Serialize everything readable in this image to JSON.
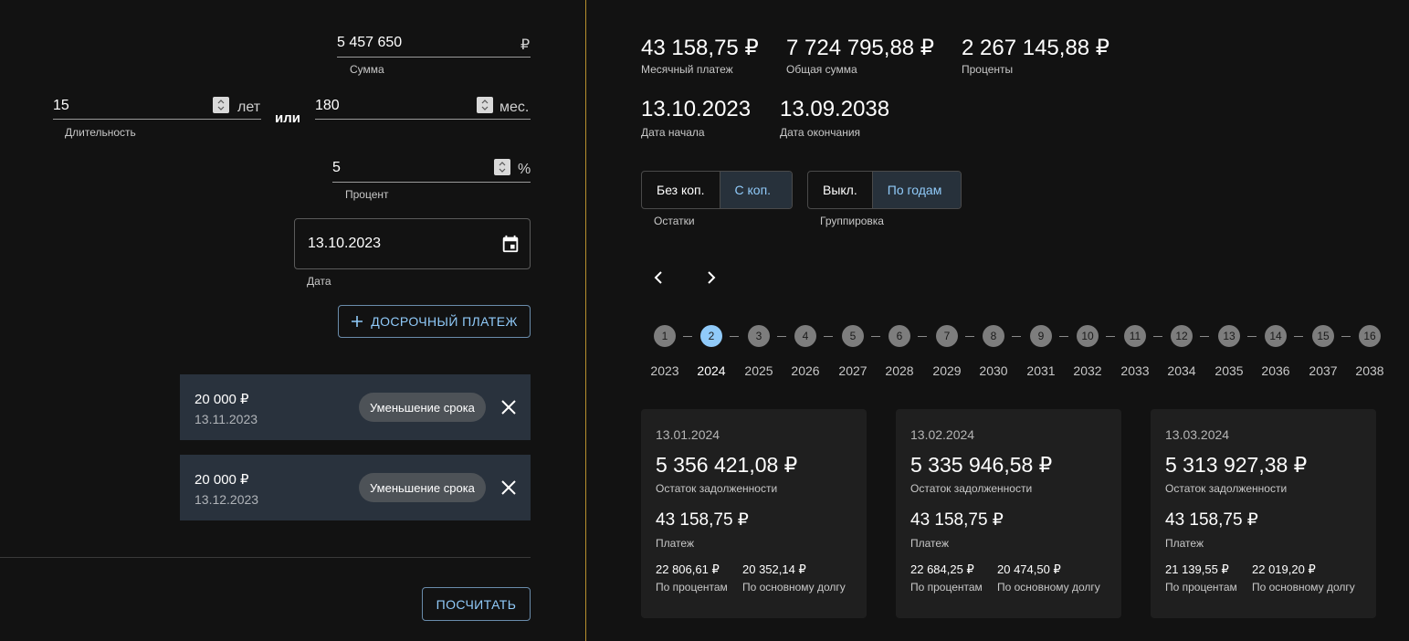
{
  "form": {
    "sum": {
      "value": "5 457 650",
      "suffix": "₽",
      "label": "Сумма"
    },
    "duration_years": {
      "value": "15",
      "suffix": "лет",
      "label": "Длительность"
    },
    "or_label": "или",
    "duration_months": {
      "value": "180",
      "suffix": "мес."
    },
    "percent": {
      "value": "5",
      "suffix": "%",
      "label": "Процент"
    },
    "date": {
      "value": "13.10.2023",
      "label": "Дата"
    },
    "early_payment_button": "ДОСРОЧНЫЙ ПЛАТЕЖ",
    "calculate_button": "ПОСЧИТАТЬ"
  },
  "early_payments": [
    {
      "amount": "20 000 ₽",
      "date": "13.11.2023",
      "type": "Уменьшение срока"
    },
    {
      "amount": "20 000 ₽",
      "date": "13.12.2023",
      "type": "Уменьшение срока"
    }
  ],
  "summary": {
    "monthly": {
      "value": "43 158,75 ₽",
      "label": "Месячный платеж"
    },
    "total": {
      "value": "7 724 795,88 ₽",
      "label": "Общая сумма"
    },
    "interest": {
      "value": "2 267 145,88 ₽",
      "label": "Проценты"
    },
    "start": {
      "value": "13.10.2023",
      "label": "Дата начала"
    },
    "end": {
      "value": "13.09.2038",
      "label": "Дата окончания"
    }
  },
  "toggles": {
    "balance": {
      "options": [
        "Без коп.",
        "С коп."
      ],
      "selected": "С коп.",
      "label": "Остатки"
    },
    "grouping": {
      "options": [
        "Выкл.",
        "По годам"
      ],
      "selected": "По годам",
      "label": "Группировка"
    }
  },
  "stepper": {
    "active_step": "2",
    "steps": [
      "1",
      "2",
      "3",
      "4",
      "5",
      "6",
      "7",
      "8",
      "9",
      "10",
      "11",
      "12",
      "13",
      "14",
      "15",
      "16"
    ],
    "years": [
      "2023",
      "2024",
      "2025",
      "2026",
      "2027",
      "2028",
      "2029",
      "2030",
      "2031",
      "2032",
      "2033",
      "2034",
      "2035",
      "2036",
      "2037",
      "2038"
    ]
  },
  "payments": [
    {
      "date": "13.01.2024",
      "balance": "5 356 421,08 ₽",
      "balance_label": "Остаток задолженности",
      "payment": "43 158,75 ₽",
      "payment_label": "Платеж",
      "interest": "22 806,61 ₽",
      "interest_label": "По процентам",
      "principal": "20 352,14 ₽",
      "principal_label": "По основному долгу"
    },
    {
      "date": "13.02.2024",
      "balance": "5 335 946,58 ₽",
      "balance_label": "Остаток задолженности",
      "payment": "43 158,75 ₽",
      "payment_label": "Платеж",
      "interest": "22 684,25 ₽",
      "interest_label": "По процентам",
      "principal": "20 474,50 ₽",
      "principal_label": "По основному долгу"
    },
    {
      "date": "13.03.2024",
      "balance": "5 313 927,38 ₽",
      "balance_label": "Остаток задолженности",
      "payment": "43 158,75 ₽",
      "payment_label": "Платеж",
      "interest": "21 139,55 ₽",
      "interest_label": "По процентам",
      "principal": "22 019,20 ₽",
      "principal_label": "По основному долгу"
    }
  ],
  "colors": {
    "accent": "#90caf9",
    "divider": "#b8902e",
    "card": "#1f1f1f",
    "early_card": "#29323d"
  },
  "icons": {
    "calendar": "calendar-icon",
    "plus": "plus-icon",
    "close": "close-icon",
    "prev": "chevron-left-icon",
    "next": "chevron-right-icon",
    "spinner": "spinner-icon"
  }
}
